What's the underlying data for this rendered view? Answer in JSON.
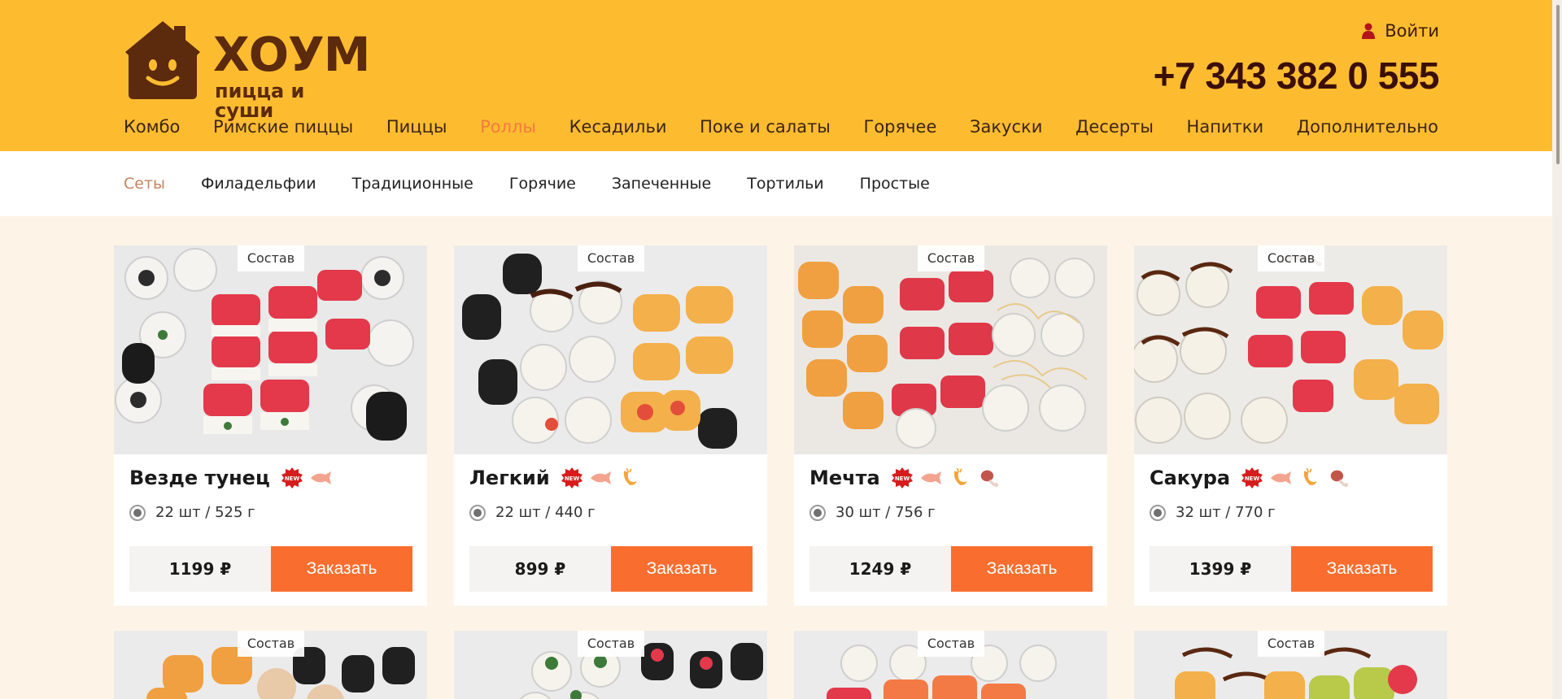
{
  "brand": {
    "name": "ХОУМ",
    "tagline": "пицца и суши",
    "primary_color": "#fdbc30",
    "accent_color": "#f96e2f",
    "logo_color": "#5c2a0c"
  },
  "header": {
    "login_label": "Войти",
    "phone": "+7 343 382 0 555"
  },
  "main_nav": {
    "items": [
      {
        "label": "Комбо"
      },
      {
        "label": "Римские пиццы"
      },
      {
        "label": "Пиццы"
      },
      {
        "label": "Роллы",
        "active": true
      },
      {
        "label": "Кесадильи"
      },
      {
        "label": "Поке и салаты"
      },
      {
        "label": "Горячее"
      },
      {
        "label": "Закуски"
      },
      {
        "label": "Десерты"
      },
      {
        "label": "Напитки"
      },
      {
        "label": "Дополнительно"
      }
    ]
  },
  "sub_nav": {
    "items": [
      {
        "label": "Сеты",
        "active": true
      },
      {
        "label": "Филадельфии"
      },
      {
        "label": "Традиционные"
      },
      {
        "label": "Горячие"
      },
      {
        "label": "Запеченные"
      },
      {
        "label": "Тортильи"
      },
      {
        "label": "Простые"
      }
    ]
  },
  "product_common": {
    "composition_label": "Состав",
    "order_label": "Заказать",
    "new_badge": "NEW"
  },
  "products": [
    {
      "title": "Везде тунец",
      "option": "22 шт / 525 г",
      "price": "1199 ₽",
      "tags": [
        "new-badge-icon",
        "fish-icon"
      ]
    },
    {
      "title": "Легкий",
      "option": "22 шт / 440 г",
      "price": "899 ₽",
      "tags": [
        "new-badge-icon",
        "fish-icon",
        "shrimp-icon"
      ]
    },
    {
      "title": "Мечта",
      "option": "30 шт / 756 г",
      "price": "1249 ₽",
      "tags": [
        "new-badge-icon",
        "fish-icon",
        "shrimp-icon",
        "chicken-leg-icon"
      ]
    },
    {
      "title": "Сакура",
      "option": "32 шт / 770 г",
      "price": "1399 ₽",
      "tags": [
        "new-badge-icon",
        "fish-icon",
        "shrimp-icon",
        "chicken-leg-icon"
      ]
    }
  ]
}
